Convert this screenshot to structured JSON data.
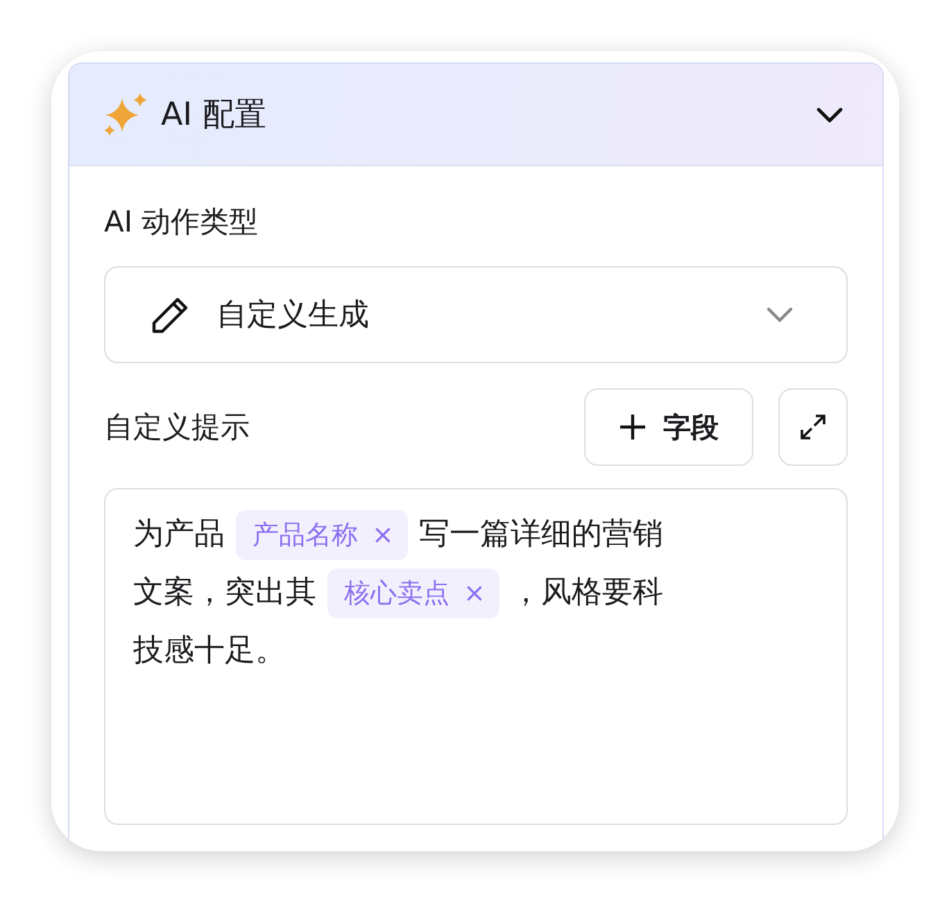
{
  "panel": {
    "title": "AI 配置",
    "expanded": true
  },
  "action_type": {
    "label": "AI 动作类型",
    "value": "自定义生成"
  },
  "prompt": {
    "label": "自定义提示",
    "add_field_button": "字段",
    "lines": [
      [
        {
          "kind": "text",
          "text": "为产品"
        },
        {
          "kind": "tag",
          "text": "产品名称",
          "remove": "×"
        },
        {
          "kind": "text",
          "text": "写一篇详细的营销"
        }
      ],
      [
        {
          "kind": "text",
          "text": "文案，突出其"
        },
        {
          "kind": "tag",
          "text": "核心卖点",
          "remove": "×"
        },
        {
          "kind": "text",
          "text": "，风格要科"
        }
      ],
      [
        {
          "kind": "text",
          "text": "技感十足。"
        }
      ]
    ]
  }
}
